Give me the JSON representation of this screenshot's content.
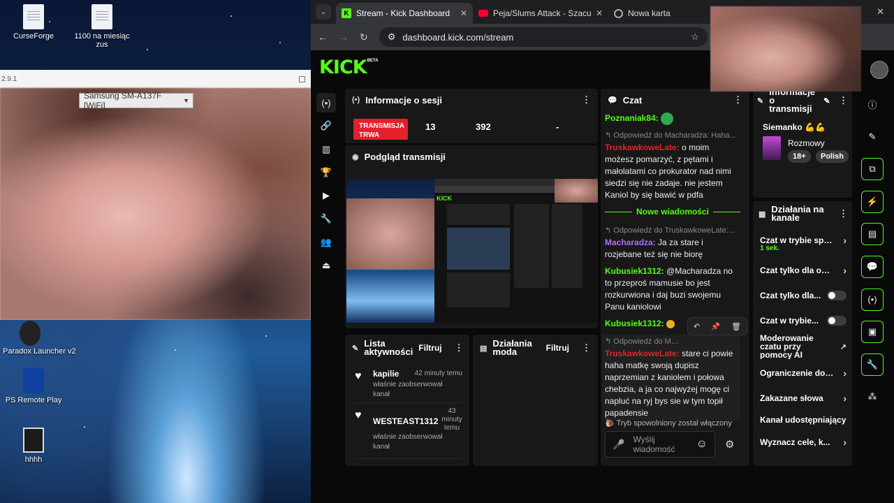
{
  "desktop": {
    "icons": [
      {
        "label": "CurseForge",
        "icon": "curseforge-icon"
      },
      {
        "label": "1100 na miesiąc zus",
        "icon": "document-icon"
      },
      {
        "label": "Paradox Launcher v2",
        "icon": "paradox-launcher-icon"
      },
      {
        "label": "PS Remote Play",
        "icon": "ps-remote-play-icon"
      },
      {
        "label": "hhhh",
        "icon": "user-photo-icon"
      }
    ]
  },
  "mirror_window": {
    "title": "2.9.1",
    "device": "Samsung SM-A137F [WiFi]"
  },
  "browser": {
    "tabs": [
      {
        "label": "Stream - Kick Dashboard",
        "active": true
      },
      {
        "label": "Peja/Slums Attack - Szacunek l...",
        "active": false
      },
      {
        "label": "Nowa karta",
        "active": false
      }
    ],
    "url": "dashboard.kick.com/stream"
  },
  "kick": {
    "logo": "KICK",
    "beta": "BETA",
    "accent": "#53fc18",
    "session": {
      "title": "Informacje o sesji",
      "live_badge": "TRANSMISJA TRWA",
      "stat1": "13",
      "stat2": "392",
      "stat3": "-"
    },
    "preview": {
      "title": "Podgląd transmisji"
    },
    "activity": {
      "title": "Lista aktywności",
      "filter": "Filtruj",
      "items": [
        {
          "name": "kapilie",
          "time": "42 minuty temu",
          "desc": "właśnie zaobserwował kanał"
        },
        {
          "name": "WESTEAST1312",
          "time": "43 minuty temu",
          "desc": "właśnie zaobserwował kanał"
        }
      ]
    },
    "mod_panel": {
      "title": "Działania moda",
      "filter": "Filtruj"
    },
    "chat": {
      "title": "Czat",
      "first_user": "Poznaniak84:",
      "reply1": "Odpowiedź do Macharadza: Haha...",
      "msg1_user": "TruskawkoweLate:",
      "msg1_text": "o moim możesz pomarzyć, z pętami i małolatami co prokurator nad nimi siedzi się nie zadaje. nie jestem Kaniol by się bawić w pdfa",
      "new_messages": "Nowe wiadomości",
      "reply2": "Odpowiedź do TruskawkoweLate:...",
      "msg2_user": "Macharadza:",
      "msg2_text": "Ja za stare i rozjebane też się nie biorę",
      "msg3_user": "Kubusiek1312:",
      "msg3_text": "@Macharadza no to przeproś mamusie bo jest rozkurwiona i daj buzi swojemu Panu kaniolowi",
      "msg4_user": "Kubusiek1312:",
      "reply3": "Odpowiedź do Machar...",
      "msg5_user": "TruskawkoweLate:",
      "msg5_text": "stare ci powie haha matkę swoją dupisz naprzemian z kaniolem i połowa chebzia, a ja co najwyżej mogę ci napluć na ryj bys sie w tym topił papadensie",
      "slow_mode_note": "Tryb spowolniony został włączony",
      "input_placeholder": "Wyślij wiadomość"
    },
    "stream_info": {
      "title": "Informacje o transmisji",
      "stream_title": "Siemanko 💪💪",
      "category": "Rozmowy",
      "tags": [
        "18+",
        "Polish"
      ]
    },
    "channel_actions": {
      "title": "Działania na kanale",
      "items": [
        {
          "label": "Czat w trybie spow",
          "sub": "1 sek.",
          "control": "chevron"
        },
        {
          "label": "Czat tylko dla obse",
          "control": "chevron"
        },
        {
          "label": "Czat tylko dla...",
          "control": "toggle"
        },
        {
          "label": "Czat w trybie...",
          "control": "toggle"
        },
        {
          "label": "Moderowanie czatu przy pomocy AI",
          "control": "external"
        },
        {
          "label": "Ograniczenie dotyc",
          "control": "chevron"
        },
        {
          "label": "Zakazane słowa",
          "control": "chevron"
        },
        {
          "label": "Kanał udostępniający",
          "control": "none"
        },
        {
          "label": "Wyznacz cele, k...",
          "control": "chevron"
        }
      ]
    }
  }
}
